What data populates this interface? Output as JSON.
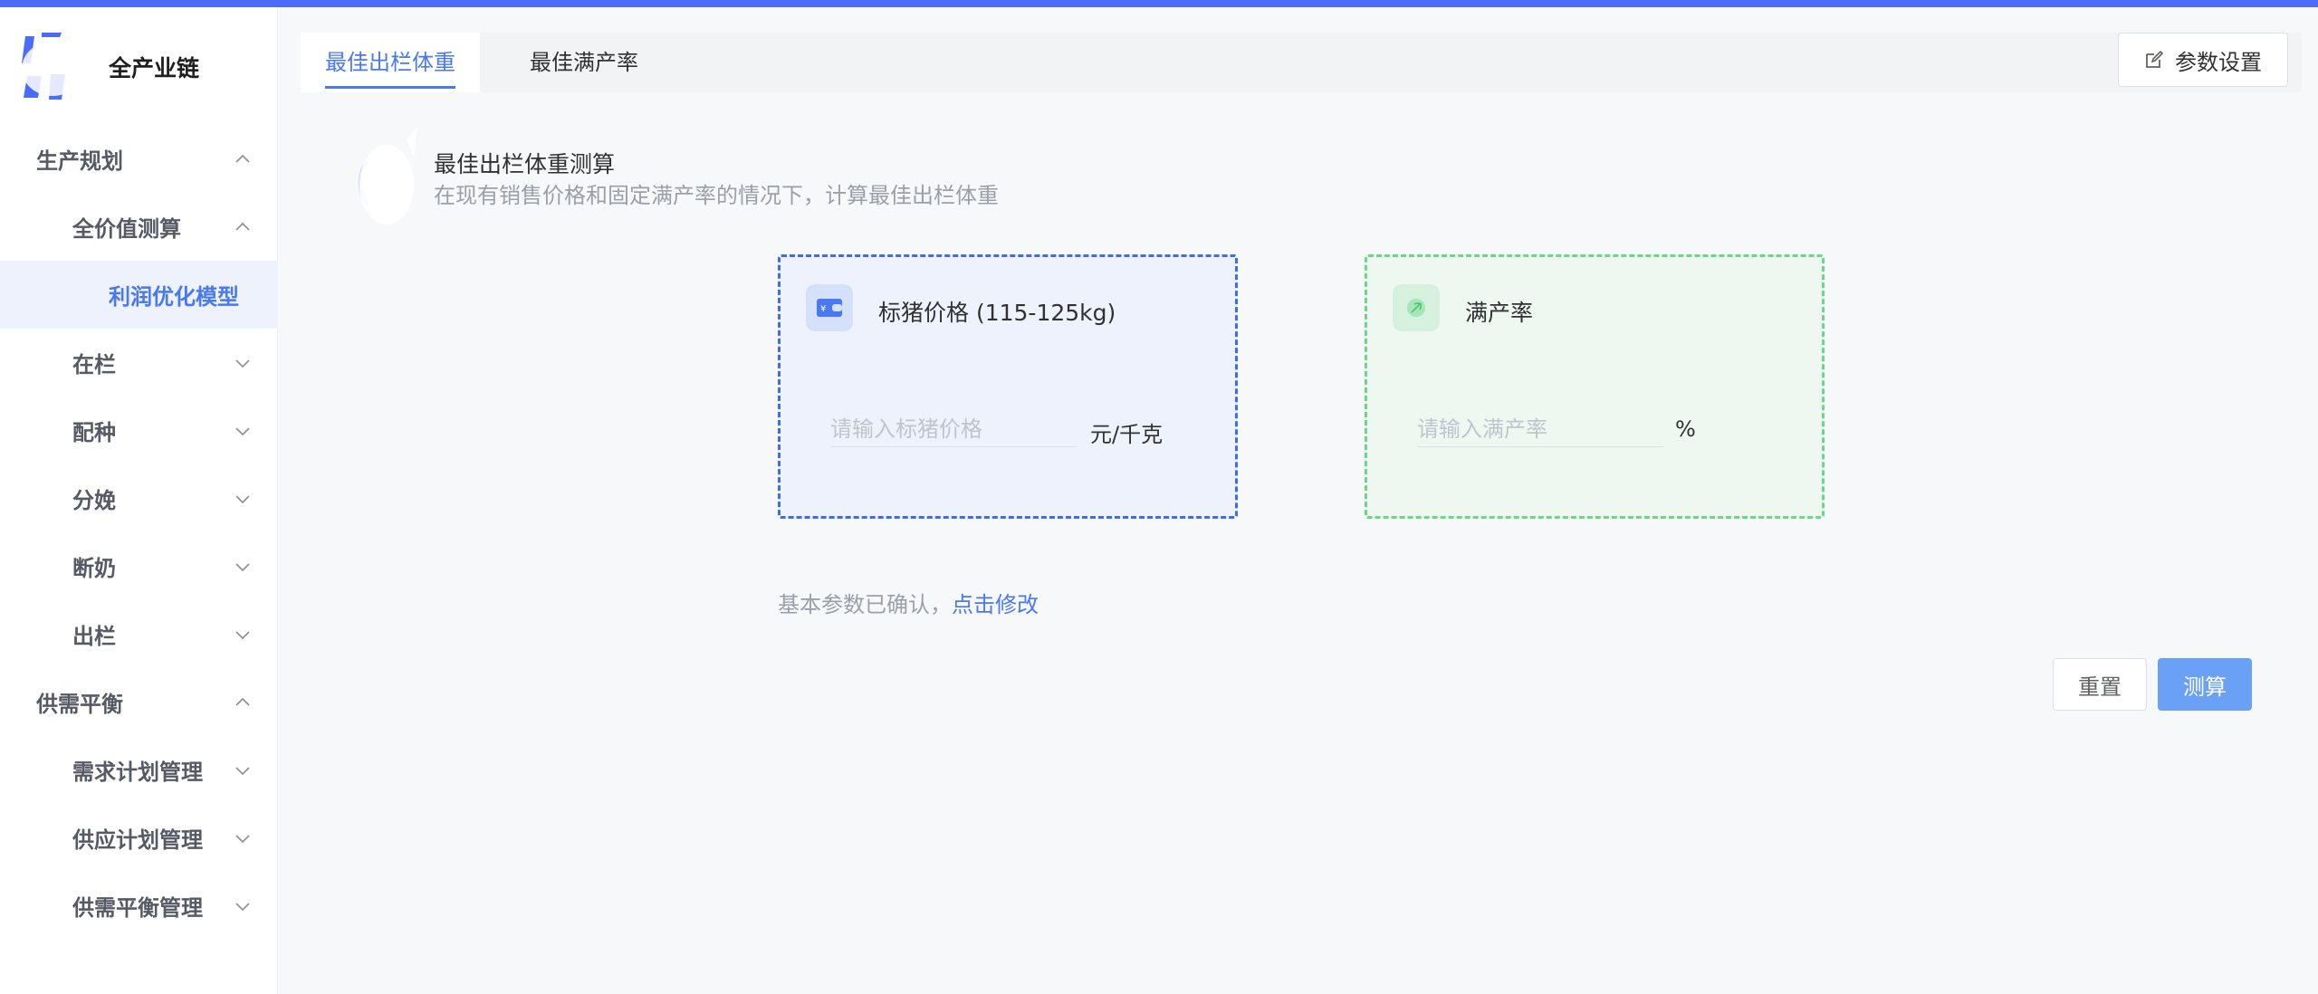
{
  "app": {
    "brand": "全产业链",
    "accent_color": "#4a6cf7",
    "logo_icon": "company-logo"
  },
  "sidebar": {
    "items": [
      {
        "label": "生产规划",
        "expanded": true
      },
      {
        "label": "全价值测算",
        "expanded": true
      },
      {
        "label": "利润优化模型",
        "selected": true
      },
      {
        "label": "在栏",
        "expanded": false
      },
      {
        "label": "配种",
        "expanded": false
      },
      {
        "label": "分娩",
        "expanded": false
      },
      {
        "label": "断奶",
        "expanded": false
      },
      {
        "label": "出栏",
        "expanded": false
      },
      {
        "label": "供需平衡",
        "expanded": true
      },
      {
        "label": "需求计划管理",
        "expanded": false
      },
      {
        "label": "供应计划管理",
        "expanded": false
      },
      {
        "label": "供需平衡管理",
        "expanded": false
      }
    ]
  },
  "tabs": [
    {
      "label": "最佳出栏体重",
      "active": true
    },
    {
      "label": "最佳满产率",
      "active": false
    }
  ],
  "toolbar": {
    "settings_label": "参数设置",
    "settings_icon": "edit-icon"
  },
  "section": {
    "title": "最佳出栏体重测算",
    "description": "在现有销售价格和固定满产率的情况下，计算最佳出栏体重"
  },
  "cards": {
    "price": {
      "title": "标猪价格 (115-125kg)",
      "placeholder": "请输入标猪价格",
      "value": "",
      "unit": "元/千克",
      "icon": "wallet-icon",
      "color": "#3f6ce8"
    },
    "rate": {
      "title": "满产率",
      "placeholder": "请输入满产率",
      "value": "",
      "unit": "%",
      "icon": "leaf-icon",
      "color": "#6ad889"
    }
  },
  "confirm": {
    "text": "基本参数已确认，",
    "link": "点击修改"
  },
  "actions": {
    "reset_label": "重置",
    "calc_label": "测算"
  }
}
